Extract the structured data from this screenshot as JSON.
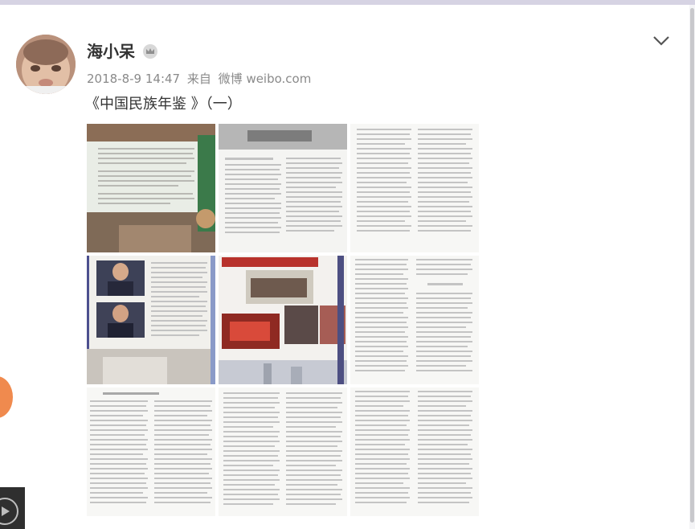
{
  "post": {
    "author": "海小呆",
    "time": "2018-8-9 14:47",
    "source_prefix": "来自",
    "source": "微博 weibo.com",
    "text": "《中国民族年鉴 》（一）"
  },
  "colors": {
    "card_bg": "#ffffff",
    "page_bg": "#ecebf2",
    "author_text": "#333333",
    "meta_text": "#8a8a8a",
    "floating_button": "#f08a4e"
  },
  "icons": {
    "badge": "crown-badge-icon",
    "menu": "chevron-down-icon",
    "video": "play-icon"
  },
  "images": [
    {
      "id": 1
    },
    {
      "id": 2
    },
    {
      "id": 3
    },
    {
      "id": 4
    },
    {
      "id": 5
    },
    {
      "id": 6
    },
    {
      "id": 7
    },
    {
      "id": 8
    },
    {
      "id": 9
    }
  ]
}
